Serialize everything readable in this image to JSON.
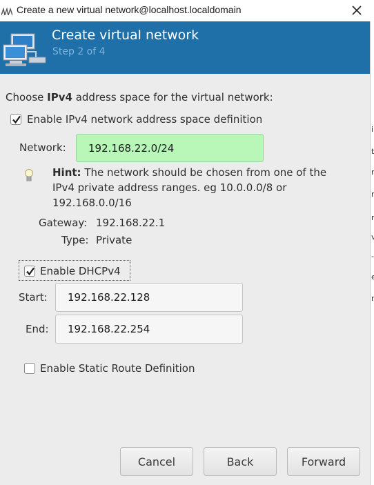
{
  "window": {
    "title": "Create a new virtual network@localhost.localdomain"
  },
  "header": {
    "title": "Create virtual network",
    "step": "Step 2 of 4"
  },
  "intro": {
    "prefix": "Choose ",
    "bold": "IPv4",
    "suffix": " address space for the virtual network:"
  },
  "ipv4": {
    "enable_label": "Enable IPv4 network address space definition",
    "enable_checked": true,
    "network_label": "Network:",
    "network_value": "192.168.22.0/24",
    "network_valid_color": "#b8f7b8"
  },
  "hint": {
    "bold": "Hint:",
    "line1": " The network should be chosen from one of the",
    "line2": "IPv4 private address ranges. eg 10.0.0.0/8 or",
    "line3": "192.168.0.0/16"
  },
  "info": {
    "gateway_label": "Gateway:",
    "gateway_value": "192.168.22.1",
    "type_label": "Type:",
    "type_value": "Private"
  },
  "dhcp": {
    "enable_label": "Enable DHCPv4",
    "enable_checked": true,
    "start_label": "Start:",
    "start_value": "192.168.22.128",
    "end_label": "End:",
    "end_value": "192.168.22.254"
  },
  "static_route": {
    "enable_label": "Enable Static Route Definition",
    "enable_checked": false
  },
  "buttons": {
    "cancel": "Cancel",
    "back": "Back",
    "forward": "Forward"
  },
  "colors": {
    "header_bg": "#1f6fa8",
    "step_text": "#7fb4dd"
  },
  "icons": {
    "app": "virt-manager-icon",
    "close": "close-icon",
    "header": "network-computers-icon",
    "hint": "lightbulb-icon"
  }
}
